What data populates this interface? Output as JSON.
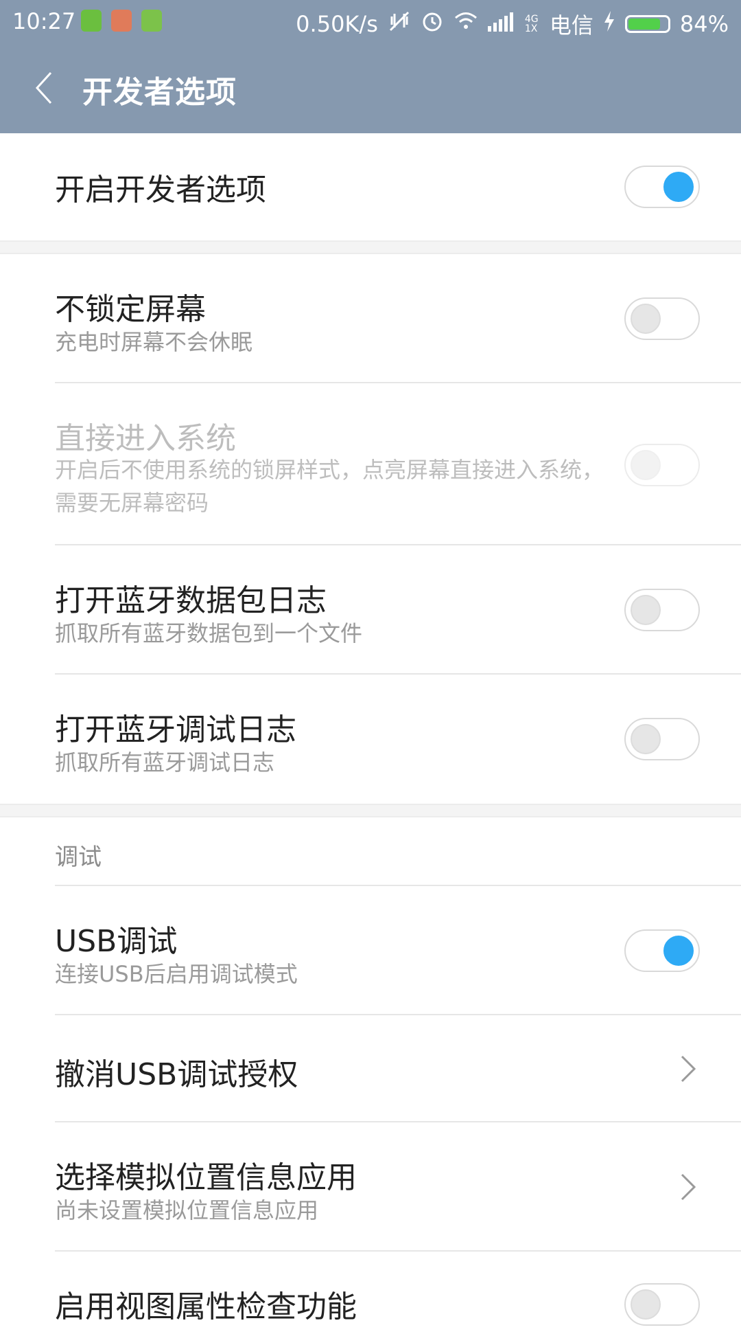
{
  "status_bar": {
    "time": "10:27",
    "network_speed": "0.50K/s",
    "network_type": "4G\n1X",
    "carrier": "电信",
    "battery_percent": "84%",
    "battery_level": 0.84,
    "icons": [
      "vibrate-off-icon",
      "alarm-icon",
      "wifi-icon",
      "signal-icon",
      "charging-icon",
      "battery-icon"
    ],
    "app_icons": [
      "battery-app-icon",
      "photo-app-icon",
      "android-app-icon"
    ]
  },
  "app_bar": {
    "title": "开发者选项"
  },
  "master_switch": {
    "label": "开启开发者选项",
    "on": true
  },
  "items": [
    {
      "title": "不锁定屏幕",
      "subtitle": "充电时屏幕不会休眠",
      "control": "toggle",
      "on": false,
      "enabled": true
    },
    {
      "title": "直接进入系统",
      "subtitle": "开启后不使用系统的锁屏样式，点亮屏幕直接进入系统，需要无屏幕密码",
      "control": "toggle",
      "on": false,
      "enabled": false
    },
    {
      "title": "打开蓝牙数据包日志",
      "subtitle": "抓取所有蓝牙数据包到一个文件",
      "control": "toggle",
      "on": false,
      "enabled": true
    },
    {
      "title": "打开蓝牙调试日志",
      "subtitle": "抓取所有蓝牙调试日志",
      "control": "toggle",
      "on": false,
      "enabled": true
    }
  ],
  "debug_section": {
    "label": "调试",
    "items": [
      {
        "title": "USB调试",
        "subtitle": "连接USB后启用调试模式",
        "control": "toggle",
        "on": true
      },
      {
        "title": "撤消USB调试授权",
        "subtitle": "",
        "control": "chevron"
      },
      {
        "title": "选择模拟位置信息应用",
        "subtitle": "尚未设置模拟位置信息应用",
        "control": "chevron"
      },
      {
        "title": "启用视图属性检查功能",
        "subtitle": "",
        "control": "toggle",
        "on": false
      }
    ]
  },
  "colors": {
    "header": "#8699af",
    "accent": "#2eaaf5",
    "battery_green": "#52d04a"
  }
}
